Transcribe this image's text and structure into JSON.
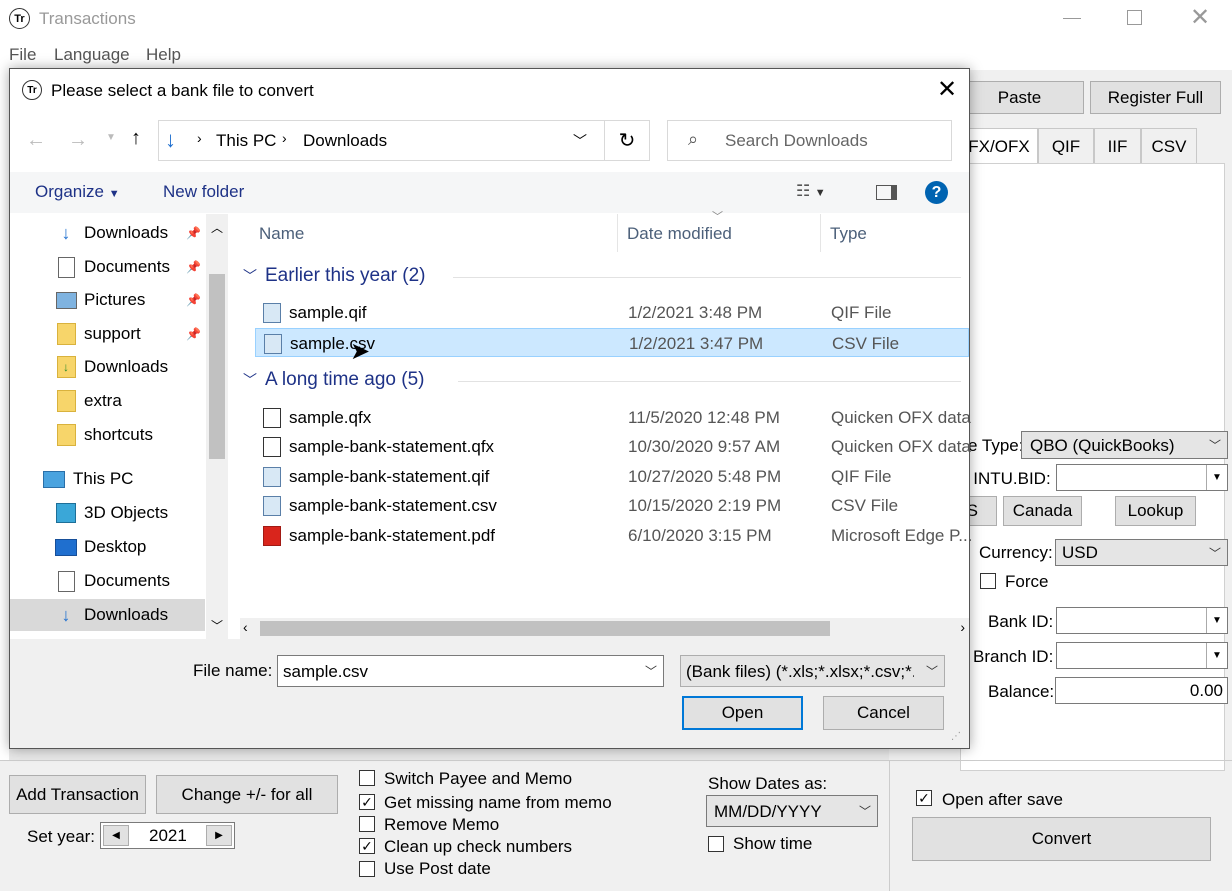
{
  "window": {
    "app_icon_text": "Tr",
    "title": "Transactions"
  },
  "menu": [
    "File",
    "Language",
    "Help"
  ],
  "right_panel": {
    "paste_label": "Paste",
    "register_label": "Register Full",
    "tabs": [
      "FX/OFX",
      "QIF",
      "IIF",
      "CSV"
    ],
    "file_type_label": "e Type:",
    "file_type_value": "QBO (QuickBooks)",
    "intu_label": "k INTU.BID:",
    "us_label": "S",
    "canada_label": "Canada",
    "lookup_label": "Lookup",
    "currency_label": "Currency:",
    "currency_value": "USD",
    "force_label": "Force",
    "bank_id_label": "Bank ID:",
    "branch_id_label": "Branch ID:",
    "balance_label": "Balance:",
    "balance_value": "0.00",
    "open_after_save_label": "Open after save",
    "convert_label": "Convert"
  },
  "bottom": {
    "add_transaction_label": "Add Transaction",
    "change_sign_label": "Change +/- for all",
    "set_year_label": "Set year:",
    "year_value": "2021",
    "options": [
      {
        "label": "Switch Payee and Memo",
        "checked": false
      },
      {
        "label": "Get missing name from memo",
        "checked": true
      },
      {
        "label": "Remove Memo",
        "checked": false
      },
      {
        "label": "Clean up check numbers",
        "checked": true
      },
      {
        "label": "Use Post date",
        "checked": false
      }
    ],
    "show_dates_label": "Show Dates as:",
    "date_format_value": "MM/DD/YYYY",
    "show_time_label": "Show time"
  },
  "dialog": {
    "icon_text": "Tr",
    "title": "Please select a bank file to convert",
    "breadcrumb": [
      "This PC",
      "Downloads"
    ],
    "search_placeholder": "Search Downloads",
    "organize_label": "Organize",
    "new_folder_label": "New folder",
    "nav": [
      {
        "label": "Downloads",
        "icon": "download-arrow-icon",
        "pinned": true
      },
      {
        "label": "Documents",
        "icon": "document-icon",
        "pinned": true
      },
      {
        "label": "Pictures",
        "icon": "pictures-icon",
        "pinned": true
      },
      {
        "label": "support",
        "icon": "folder-icon",
        "pinned": true
      },
      {
        "label": "Downloads",
        "icon": "folder-download-icon",
        "pinned": false
      },
      {
        "label": "extra",
        "icon": "folder-icon",
        "pinned": false
      },
      {
        "label": "shortcuts",
        "icon": "folder-icon",
        "pinned": false
      },
      {
        "label": "This PC",
        "icon": "computer-icon",
        "pinned": false
      },
      {
        "label": "3D Objects",
        "icon": "cube-icon",
        "pinned": false
      },
      {
        "label": "Desktop",
        "icon": "desktop-icon",
        "pinned": false
      },
      {
        "label": "Documents",
        "icon": "document-icon",
        "pinned": false
      },
      {
        "label": "Downloads",
        "icon": "download-arrow-icon",
        "pinned": false
      }
    ],
    "columns": [
      "Name",
      "Date modified",
      "Type"
    ],
    "groups": [
      {
        "label": "Earlier this year (2)",
        "files": [
          {
            "name": "sample.qif",
            "date": "1/2/2021 3:48 PM",
            "type": "QIF File",
            "icon": "text-file-icon"
          },
          {
            "name": "sample.csv",
            "date": "1/2/2021 3:47 PM",
            "type": "CSV File",
            "icon": "text-file-icon",
            "selected": true
          }
        ]
      },
      {
        "label": "A long time ago (5)",
        "files": [
          {
            "name": "sample.qfx",
            "date": "11/5/2020 12:48 PM",
            "type": "Quicken OFX data",
            "icon": "quicken-file-icon"
          },
          {
            "name": "sample-bank-statement.qfx",
            "date": "10/30/2020 9:57 AM",
            "type": "Quicken OFX data",
            "icon": "quicken-file-icon"
          },
          {
            "name": "sample-bank-statement.qif",
            "date": "10/27/2020 5:48 PM",
            "type": "QIF File",
            "icon": "text-file-icon"
          },
          {
            "name": "sample-bank-statement.csv",
            "date": "10/15/2020 2:19 PM",
            "type": "CSV File",
            "icon": "text-file-icon"
          },
          {
            "name": "sample-bank-statement.pdf",
            "date": "6/10/2020 3:15 PM",
            "type": "Microsoft Edge P...",
            "icon": "pdf-file-icon"
          }
        ]
      }
    ],
    "file_name_label": "File name:",
    "file_name_value": "sample.csv",
    "filter_value": "(Bank files) (*.xls;*.xlsx;*.csv;*.t",
    "open_label": "Open",
    "cancel_label": "Cancel"
  },
  "colors": {
    "accent": "#0078d7",
    "selection": "#cce8ff",
    "group_header": "#1e3287"
  }
}
